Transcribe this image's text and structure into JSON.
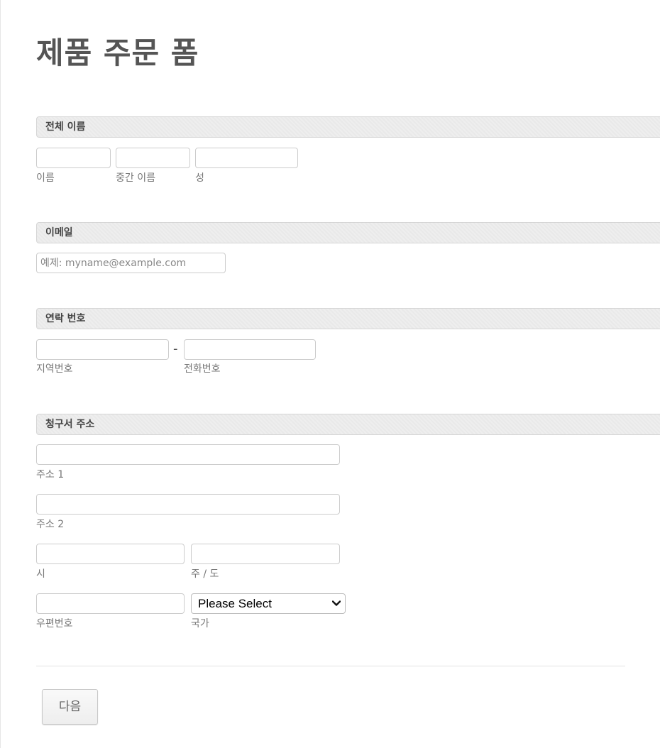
{
  "form": {
    "title": "제품 주문 폼"
  },
  "full_name": {
    "label": "전체 이름",
    "first_value": "",
    "middle_value": "",
    "last_value": "",
    "first_sublabel": "이름",
    "middle_sublabel": "중간 이름",
    "last_sublabel": "성"
  },
  "email": {
    "label": "이메일",
    "value": "",
    "placeholder": "예제: myname@example.com"
  },
  "phone": {
    "label": "연락 번호",
    "area_value": "",
    "number_value": "",
    "separator": "-",
    "area_sublabel": "지역번호",
    "number_sublabel": "전화번호"
  },
  "address": {
    "label": "청구서 주소",
    "line1_value": "",
    "line1_sublabel": "주소 1",
    "line2_value": "",
    "line2_sublabel": "주소 2",
    "city_value": "",
    "city_sublabel": "시",
    "state_value": "",
    "state_sublabel": "주 / 도",
    "zip_value": "",
    "zip_sublabel": "우편번호",
    "country_selected": "Please Select",
    "country_sublabel": "국가"
  },
  "buttons": {
    "next_label": "다음"
  },
  "icons": {
    "country_dropdown": "chevron-down-icon"
  }
}
